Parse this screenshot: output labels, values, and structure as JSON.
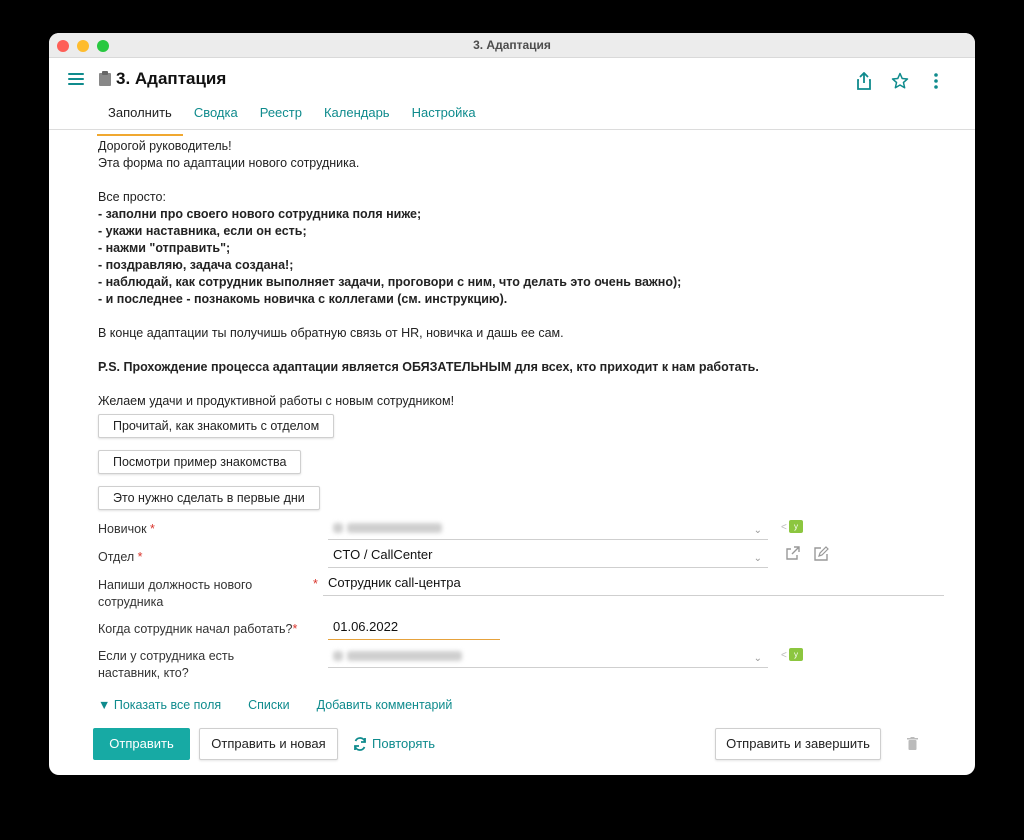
{
  "window": {
    "title": "3. Адаптация"
  },
  "header": {
    "title": "3. Адаптация"
  },
  "tabs": [
    {
      "label": "Заполнить"
    },
    {
      "label": "Сводка"
    },
    {
      "label": "Реестр"
    },
    {
      "label": "Календарь"
    },
    {
      "label": "Настройка"
    }
  ],
  "intro": {
    "greeting": "Дорогой руководитель!",
    "subtitle": "Эта форма по адаптации нового сотрудника.",
    "simple": "Все просто:",
    "steps": [
      "- заполни про своего нового сотрудника поля ниже;",
      "- укажи наставника, если он есть;",
      "- нажми \"отправить\";",
      "- поздравляю, задача создана!;",
      "- наблюдай, как сотрудник выполняет задачи, проговори с ним, что делать это очень важно);",
      "- и последнее - познакомь новичка с коллегами (см. инструкцию)."
    ],
    "feedback": "В конце адаптации ты получишь обратную связь от HR, новичка и дашь ее сам.",
    "ps": "P.S. Прохождение процесса адаптации является ОБЯЗАТЕЛЬНЫМ для всех, кто приходит к нам работать.",
    "wish": "Желаем удачи и продуктивной работы с новым сотрудником!"
  },
  "info_buttons": [
    {
      "label": "Прочитай, как знакомить с отделом"
    },
    {
      "label": "Посмотри пример знакомства"
    },
    {
      "label": "Это нужно сделать в первые дни"
    }
  ],
  "form": {
    "newbie": {
      "label": "Новичок",
      "required_mark": "*"
    },
    "department": {
      "label": "Отдел",
      "required_mark": "*",
      "value": "CTO / CallCenter"
    },
    "position": {
      "label": "Напиши должность нового сотрудника",
      "required_mark": "*",
      "value": "Сотрудник call-центра"
    },
    "start_date": {
      "label": "Когда сотрудник начал работать?",
      "required_mark": "*",
      "value": "01.06.2022"
    },
    "mentor": {
      "label": "Если у сотрудника есть наставник, кто?"
    }
  },
  "links": {
    "show_all": "▼ Показать все поля",
    "lists": "Списки",
    "add_comment": "Добавить комментарий"
  },
  "actions": {
    "submit": "Отправить",
    "submit_new": "Отправить и новая",
    "repeat": "Повторять",
    "submit_finish": "Отправить и завершить"
  },
  "colors": {
    "accent": "#0f8b8d",
    "primary_button": "#17aaa4",
    "active_tab_underline": "#f0a830",
    "required": "#d9342b"
  }
}
